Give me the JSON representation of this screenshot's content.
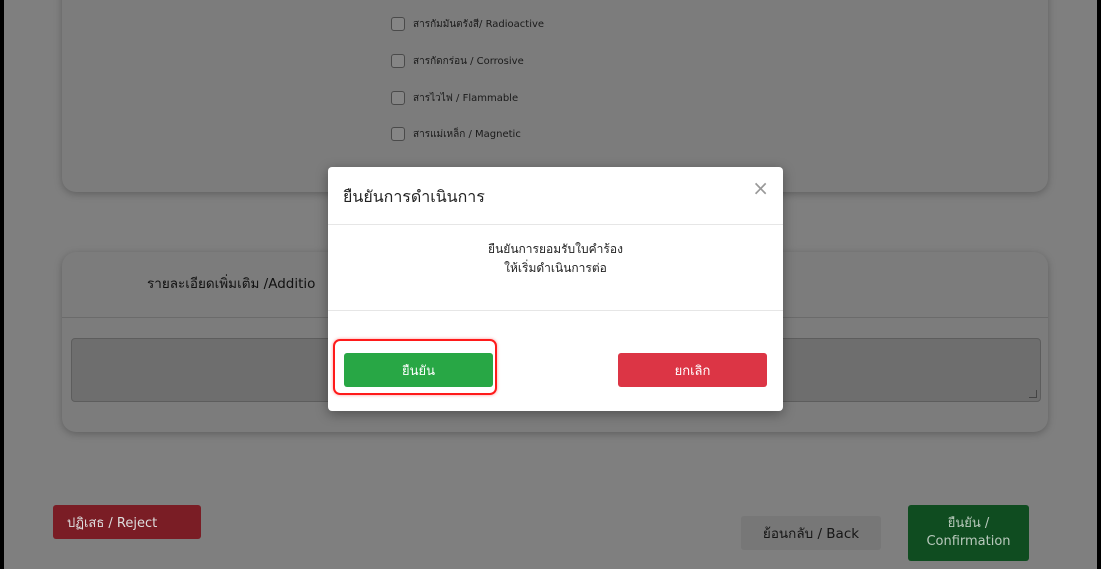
{
  "hazard_options": [
    {
      "label": "สารกัมมันตรังสี/ Radioactive",
      "checked": false
    },
    {
      "label": "สารกัดกร่อน / Corrosive",
      "checked": false
    },
    {
      "label": "สารไวไฟ / Flammable",
      "checked": false
    },
    {
      "label": "สารแม่เหล็ก / Magnetic",
      "checked": false
    }
  ],
  "details": {
    "title": "รายละเอียดเพิ่มเติม /Additio",
    "textarea_value": ""
  },
  "actions": {
    "reject_label": "ปฏิเสธ / Reject",
    "back_label": "ย้อนกลับ / Back",
    "confirm_line1": "ยืนยัน /",
    "confirm_line2": "Confirmation"
  },
  "modal": {
    "title": "ยืนยันการดำเนินการ",
    "close_glyph": "×",
    "message_line1": "ยืนยันการยอมรับใบคำร้อง",
    "message_line2": "ให้เริ่มดำเนินการต่อ",
    "ok_label": "ยืนยัน",
    "cancel_label": "ยกเลิก"
  },
  "colors": {
    "ok_green": "#28a745",
    "cancel_red": "#dc3545",
    "highlight_red": "#ff1a1a"
  },
  "icons": {
    "checkbox": "checkbox-icon",
    "close": "close-icon",
    "resize": "resize-grip-icon"
  }
}
